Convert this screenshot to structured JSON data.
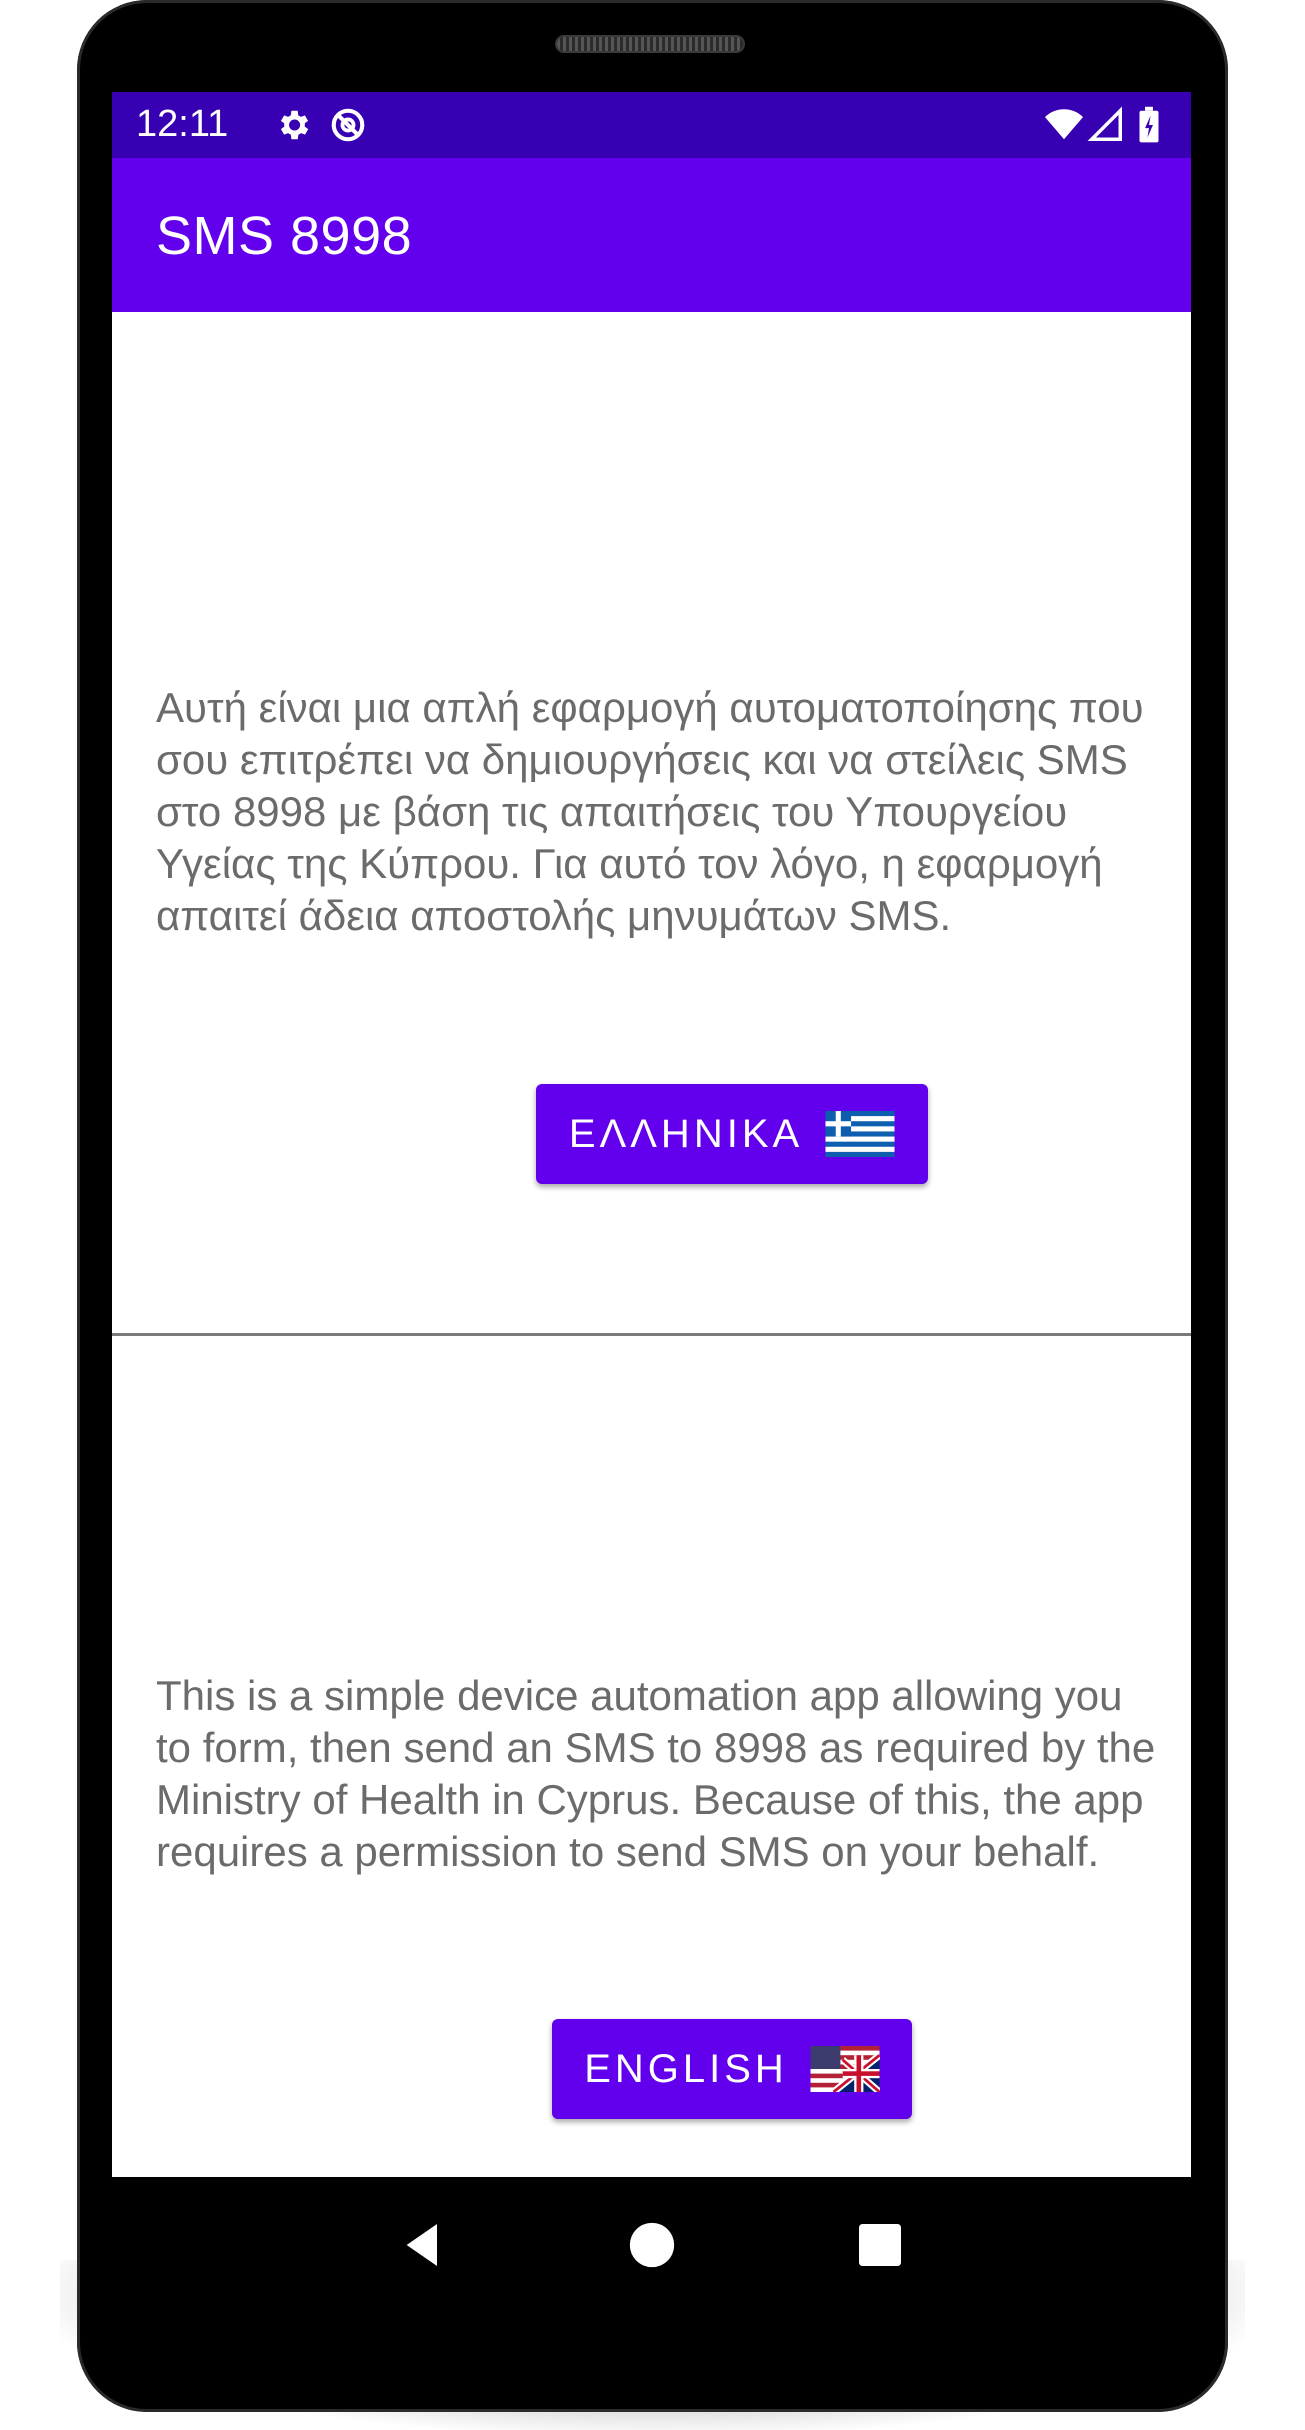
{
  "status_bar": {
    "time": "12:11",
    "left_icons": [
      "gear-icon",
      "sync-off-icon"
    ],
    "right_icons": [
      "wifi-icon",
      "signal-icon",
      "battery-charging-icon"
    ]
  },
  "app_bar": {
    "title": "SMS 8998"
  },
  "sections": [
    {
      "text": "Αυτή είναι μια απλή εφαρμογή αυτοματοποίησης που σου επιτρέπει να δημιουργήσεις και να στείλεις SMS στο 8998 με βάση τις απαιτήσεις του Υπουργείου Υγείας της Κύπρου. Για αυτό τον λόγο, η εφαρμογή απαιτεί άδεια αποστολής μηνυμάτων SMS.",
      "button_label": "ΕΛΛΗΝΙΚΑ",
      "flag_icon": "greece-flag-icon"
    },
    {
      "text": "This is a simple device automation app allowing you to form, then send an SMS to 8998 as required by the Ministry of Health in Cyprus. Because of this, the app requires a permission to send SMS on your behalf.",
      "button_label": "ENGLISH",
      "flag_icon": "us-uk-flag-icon"
    }
  ],
  "nav_bar": {
    "items": [
      "back-icon",
      "home-icon",
      "recents-icon"
    ]
  },
  "colors": {
    "status_bar": "#3700b3",
    "app_bar": "#6200ee",
    "button": "#6200ee",
    "body_text": "#6b6b6b"
  }
}
